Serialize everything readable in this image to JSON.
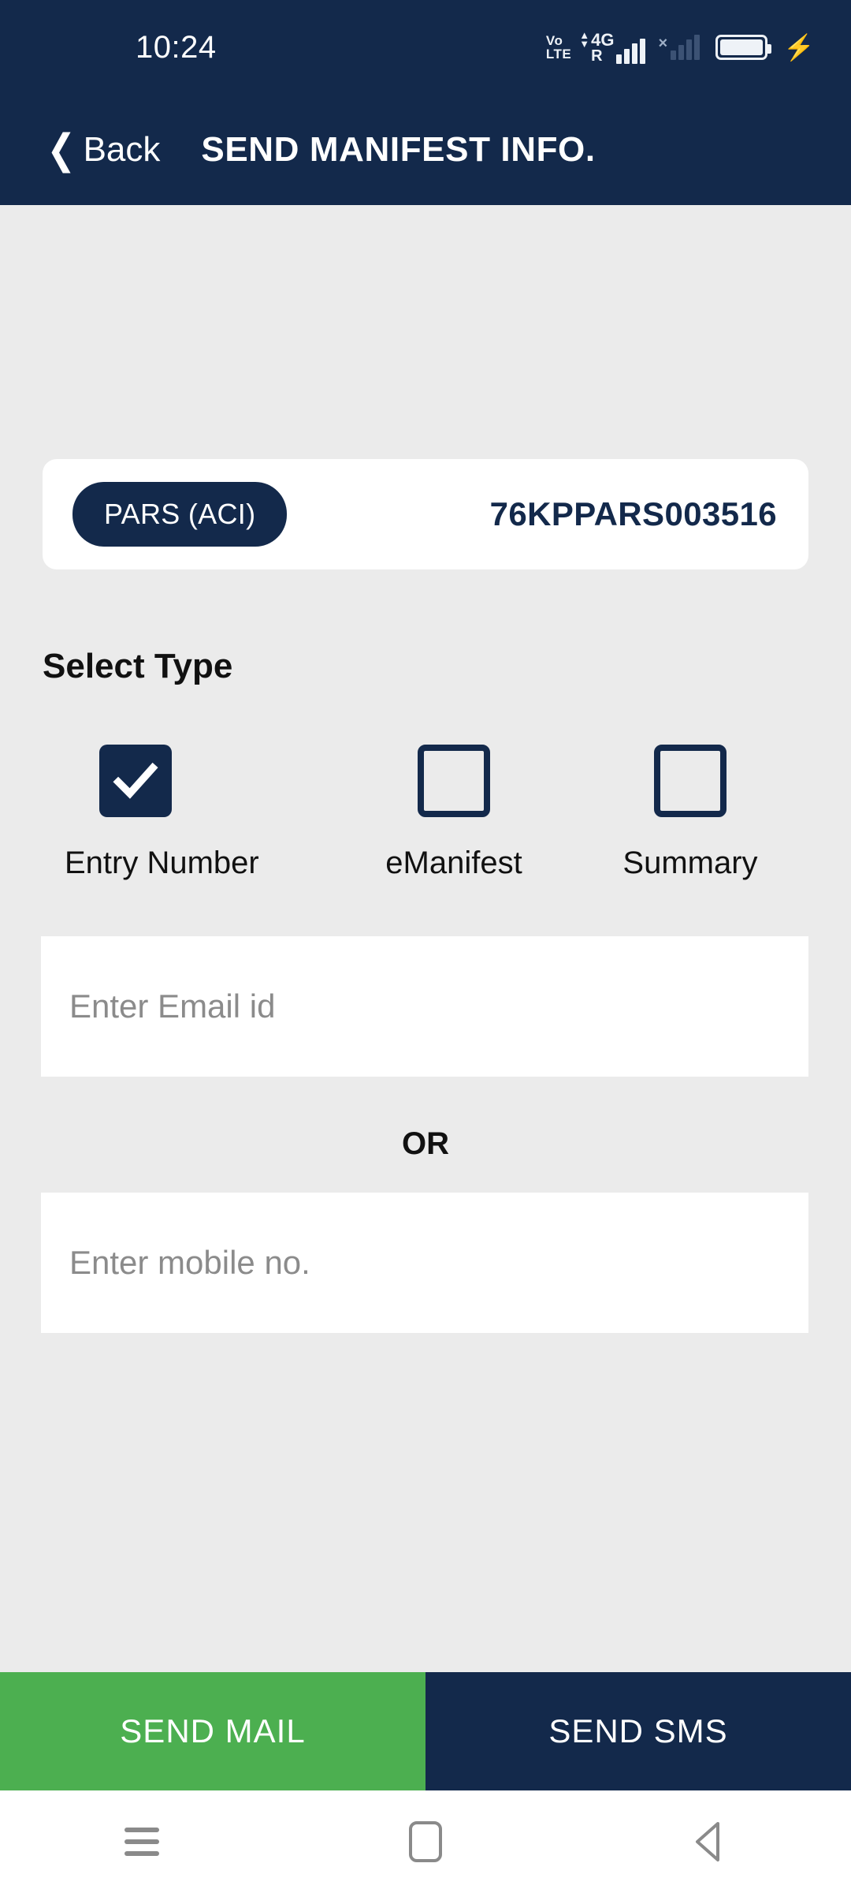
{
  "status_bar": {
    "time": "10:24",
    "volte_top": "Vo",
    "volte_bottom": "LTE",
    "network_type": "4G",
    "roaming": "R",
    "no_service_mark": "×",
    "icons": [
      "volte-icon",
      "signal-4g-roaming-icon",
      "signal-no-service-icon",
      "battery-icon",
      "charging-bolt-icon"
    ]
  },
  "app_bar": {
    "back_label": "Back",
    "back_icon": "chevron-left-icon",
    "title": "SEND MANIFEST INFO."
  },
  "pars_card": {
    "badge_label": "PARS (ACI)",
    "number": "76KPPARS003516"
  },
  "select_type": {
    "heading": "Select Type",
    "options": [
      {
        "label": "Entry Number",
        "checked": true
      },
      {
        "label": "eManifest",
        "checked": false
      },
      {
        "label": "Summary",
        "checked": false
      }
    ]
  },
  "form": {
    "email_placeholder": "Enter Email id",
    "email_value": "",
    "divider_label": "OR",
    "mobile_placeholder": "Enter mobile no.",
    "mobile_value": ""
  },
  "actions": {
    "send_mail_label": "SEND MAIL",
    "send_sms_label": "SEND SMS"
  },
  "nav_bar": {
    "recent_icon": "recents-menu-icon",
    "home_icon": "home-square-icon",
    "back_icon": "back-triangle-icon"
  },
  "colors": {
    "navy": "#13294b",
    "green": "#4caf50",
    "page_bg": "#ebebeb",
    "card_bg": "#ffffff",
    "placeholder": "#8b8b8b"
  }
}
